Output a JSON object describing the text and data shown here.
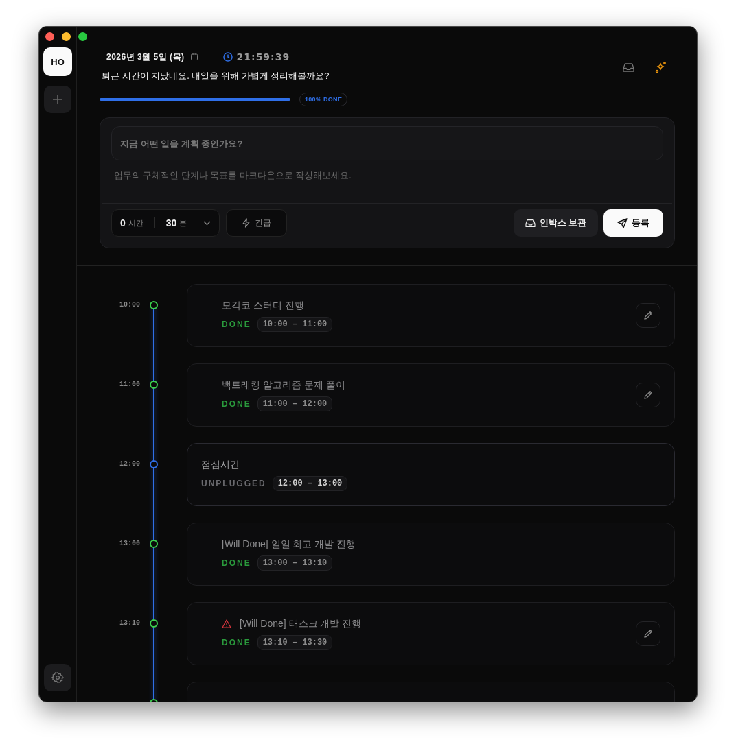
{
  "window": {
    "controls": [
      {
        "color": "#ff5f57"
      },
      {
        "color": "#febc2e"
      },
      {
        "color": "#28c840"
      }
    ]
  },
  "sidebar": {
    "workspace": "HO"
  },
  "header": {
    "date": "2026년 3월 5일 (목)",
    "time": "21:59:39",
    "message": "퇴근 시간이 지났네요. 내일을 위해 가볍게 정리해볼까요?",
    "progress": {
      "level": 1,
      "label": "100% DONE"
    }
  },
  "composer": {
    "title_placeholder": "지금 어떤 일을 계획 중인가요?",
    "description_placeholder": "업무의 구체적인 단계나 목표를 마크다운으로 작성해보세요.",
    "hours": {
      "value": "0",
      "unit": "시간"
    },
    "minutes": {
      "value": "30",
      "unit": "분"
    },
    "urgent_button": "긴급",
    "inbox_button": "인박스 보관",
    "submit_button": "등록"
  },
  "timeline": [
    {
      "time": "10:00",
      "kind": "task",
      "title": "모각코 스터디 진행",
      "status": "DONE",
      "range": "10:00 – 11:00",
      "editable": true,
      "warning": false,
      "color": "#3ccf4e"
    },
    {
      "time": "11:00",
      "kind": "task",
      "title": "백트래킹 알고리즘 문제 풀이",
      "status": "DONE",
      "range": "11:00 – 12:00",
      "editable": true,
      "warning": false,
      "color": "#3ccf4e"
    },
    {
      "time": "12:00",
      "kind": "break",
      "title": "점심시간",
      "status": "UNPLUGGED",
      "range": "12:00 – 13:00",
      "editable": false,
      "warning": false,
      "color": "#2f6fe8"
    },
    {
      "time": "13:00",
      "kind": "task",
      "title": "[Will Done] 일일 회고 개발 진행",
      "status": "DONE",
      "range": "13:00 – 13:10",
      "editable": false,
      "warning": false,
      "color": "#3ccf4e"
    },
    {
      "time": "13:10",
      "kind": "task",
      "title": "[Will Done] 태스크 개발 진행",
      "status": "DONE",
      "range": "13:10 – 13:30",
      "editable": true,
      "warning": true,
      "color": "#3ccf4e"
    },
    {
      "kind": "task",
      "editable": false,
      "warning": false,
      "color": "#3ccf4e"
    }
  ]
}
